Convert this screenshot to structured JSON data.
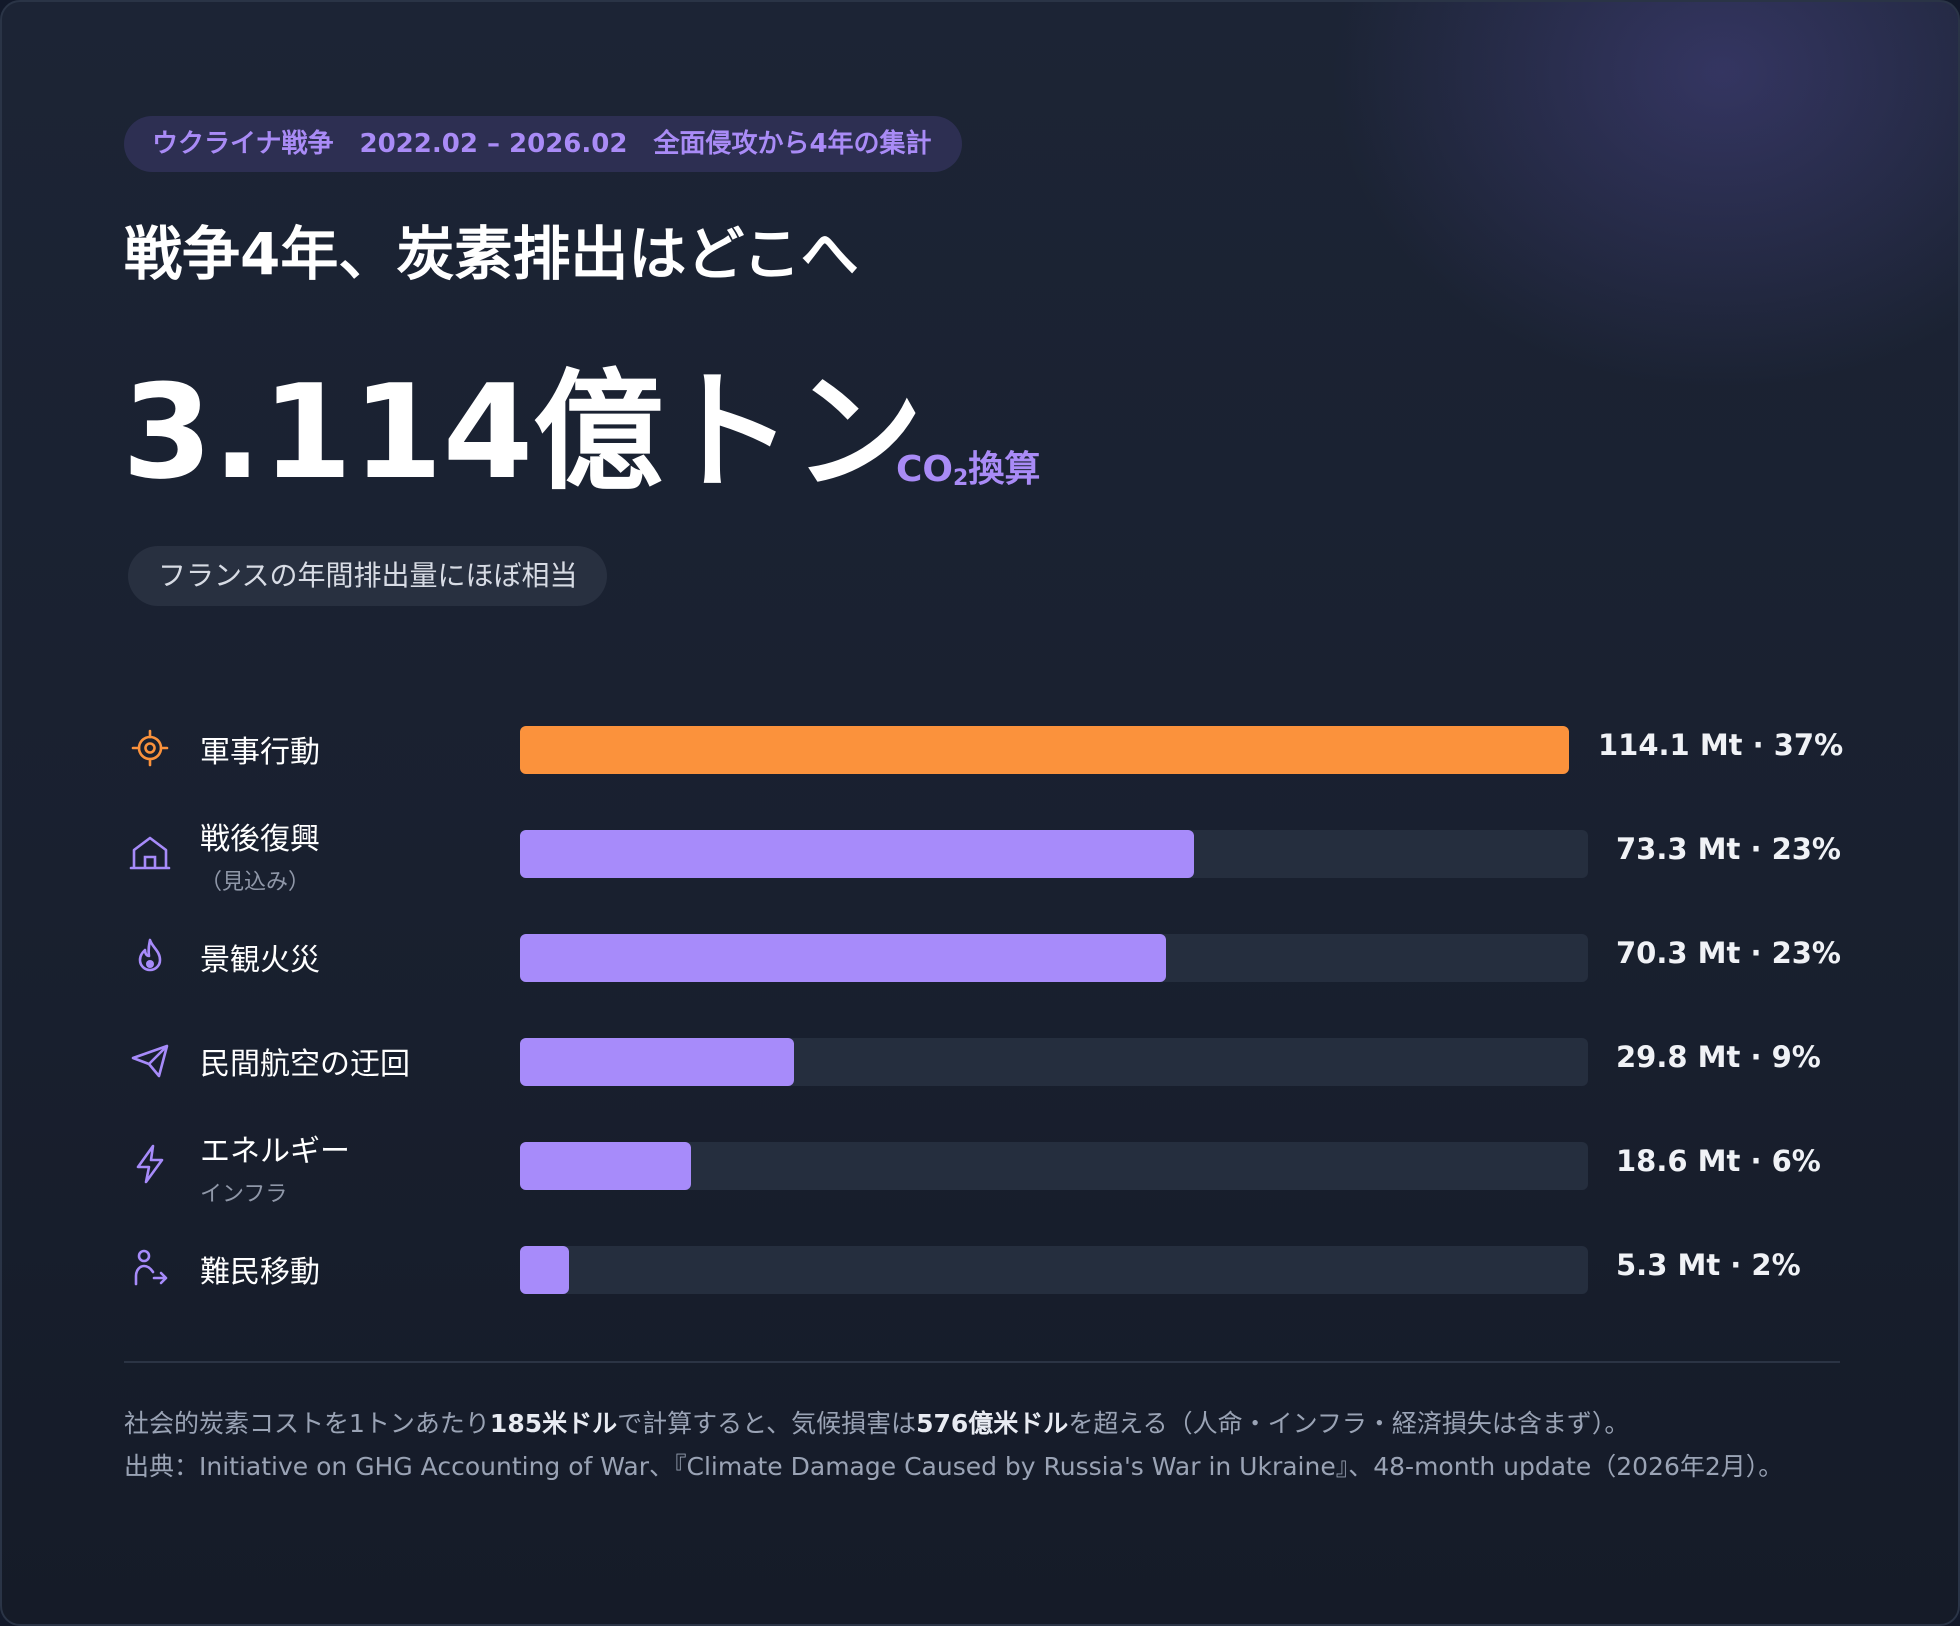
{
  "header": {
    "tag_parts": [
      "ウクライナ戦争",
      "2022.02 – 2026.02",
      "全面侵攻から4年の集計"
    ],
    "title": "戦争4年、炭素排出はどこへ",
    "total": "3.114億トン",
    "unit_prefix": "CO",
    "unit_sub": "2",
    "unit_suffix": "換算",
    "comparison": "フランスの年間排出量にほぼ相当"
  },
  "colors": {
    "highlight": "#fb923c",
    "bar": "#a78bfa",
    "track": "#252e3e"
  },
  "chart_data": {
    "type": "bar",
    "orientation": "horizontal",
    "xlim": [
      0,
      114.1
    ],
    "categories": [
      "軍事行動",
      "戦後復興",
      "景観火災",
      "民間航空の迂回",
      "エネルギー",
      "難民移動"
    ],
    "sublabels": [
      "",
      "（見込み）",
      "",
      "",
      "インフラ",
      ""
    ],
    "icons": [
      "target-icon",
      "house-icon",
      "flame-icon",
      "plane-icon",
      "bolt-icon",
      "person-walking-icon"
    ],
    "values": [
      114.1,
      73.3,
      70.3,
      29.8,
      18.6,
      5.3
    ],
    "percents": [
      37,
      23,
      23,
      9,
      6,
      2
    ],
    "value_labels": [
      "114.1 Mt · 37%",
      "73.3 Mt · 23%",
      "70.3 Mt · 23%",
      "29.8 Mt · 9%",
      "18.6 Mt · 6%",
      "5.3 Mt · 2%"
    ],
    "highlight_index": 0
  },
  "footer": {
    "note_pre": "社会的炭素コストを1トンあたり",
    "note_b1": "185米ドル",
    "note_mid": "で計算すると、気候損害は",
    "note_b2": "576億米ドル",
    "note_post": "を超える（人命・インフラ・経済損失は含まず）。",
    "source": "出典：Initiative on GHG Accounting of War、『Climate Damage Caused by Russia's War in Ukraine』、48-month update（2026年2月）。"
  }
}
